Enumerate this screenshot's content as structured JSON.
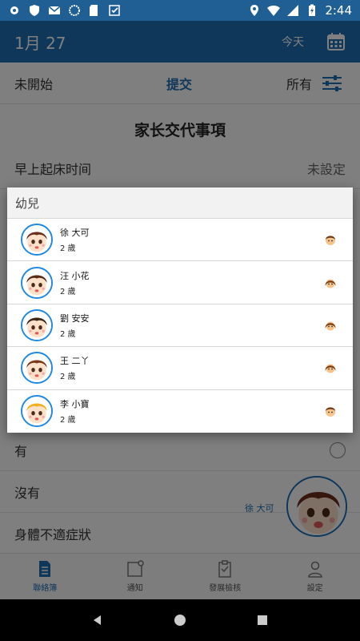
{
  "status_bar": {
    "time": "2:44"
  },
  "header": {
    "date": "1月 27",
    "today_label": "今天"
  },
  "tabs": {
    "unstarted": "未開始",
    "submitted": "提交",
    "all": "所有"
  },
  "section": {
    "title": "家长交代事項"
  },
  "rows": {
    "wake_label": "早上起床时间",
    "wake_value": "未設定",
    "yes_label": "有",
    "no_label": "沒有",
    "symptoms_label": "身體不適症狀"
  },
  "fab": {
    "name": "徐 大可"
  },
  "dialog": {
    "title": "幼兒",
    "children": [
      {
        "name": "徐 大可",
        "age": "2 歲",
        "gender": "boy",
        "hair": "#6b2f1a"
      },
      {
        "name": "汪 小花",
        "age": "2 歲",
        "gender": "girl",
        "hair": "#5a2a14"
      },
      {
        "name": "劉 安安",
        "age": "2 歲",
        "gender": "girl",
        "hair": "#3a2418"
      },
      {
        "name": "王 二丫",
        "age": "2 歲",
        "gender": "girl",
        "hair": "#7a3a1a"
      },
      {
        "name": "李 小寶",
        "age": "2 歲",
        "gender": "boy",
        "hair": "#f0b020"
      }
    ]
  },
  "bottom_nav": {
    "contact": "聯絡簿",
    "notice": "通知",
    "development": "發展檢核",
    "settings": "設定"
  },
  "colors": {
    "primary": "#1e6fb5",
    "status": "#1f5f93"
  }
}
